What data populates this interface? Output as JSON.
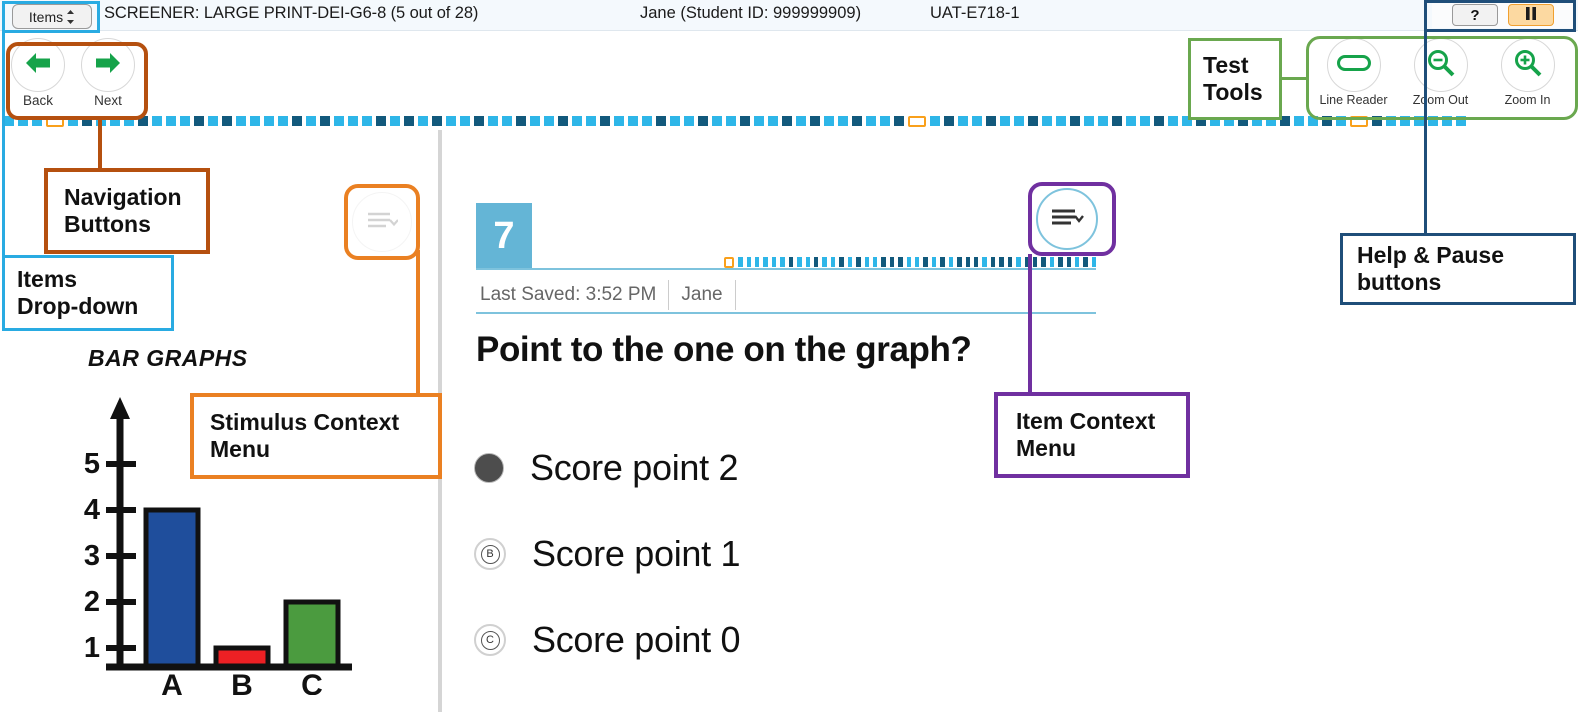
{
  "header": {
    "items_dropdown_label": "Items",
    "test_title": "SCREENER: LARGE PRINT-DEI-G6-8 (5 out of 28)",
    "student_info": "Jane (Student ID: 999999909)",
    "session_id": "UAT-E718-1",
    "help_label": "?",
    "pause_label": "II"
  },
  "nav": {
    "back_label": "Back",
    "next_label": "Next"
  },
  "tools": {
    "line_reader_label": "Line Reader",
    "zoom_out_label": "Zoom Out",
    "zoom_in_label": "Zoom In"
  },
  "stimulus": {
    "title": "BAR GRAPHS"
  },
  "item": {
    "number": "7",
    "last_saved": "Last Saved: 3:52 PM",
    "saved_by": "Jane",
    "question": "Point to the one on the graph?",
    "choices": [
      {
        "letter": "A",
        "text": "Score point 2",
        "selected": true
      },
      {
        "letter": "B",
        "text": "Score point 1",
        "selected": false
      },
      {
        "letter": "C",
        "text": "Score point 0",
        "selected": false
      }
    ]
  },
  "callouts": {
    "items_dropdown": {
      "line1": "Items",
      "line2": "Drop-down",
      "color": "#29abe2"
    },
    "navigation_buttons": {
      "line1": "Navigation",
      "line2": "Buttons",
      "color": "#b5500f"
    },
    "stimulus_context_menu": {
      "line1": "Stimulus Context",
      "line2": "Menu",
      "color": "#ea8022"
    },
    "item_context_menu": {
      "line1": "Item Context",
      "line2": "Menu",
      "color": "#7030a0"
    },
    "test_tools": {
      "line1": "Test",
      "line2": "Tools",
      "color": "#6aa84f"
    },
    "help_pause": {
      "line1": "Help & Pause",
      "line2": "buttons",
      "color": "#1f4e79"
    }
  },
  "chart_data": {
    "type": "bar",
    "title": "BAR GRAPHS",
    "categories": [
      "A",
      "B",
      "C"
    ],
    "values": [
      4,
      1,
      2
    ],
    "colors": [
      "#1f4e9c",
      "#ed2024",
      "#4b9b3f"
    ],
    "ylim": [
      0,
      5
    ],
    "yticks": [
      1,
      2,
      3,
      4,
      5
    ],
    "xlabel": "",
    "ylabel": "",
    "grid": false,
    "legend": false
  }
}
